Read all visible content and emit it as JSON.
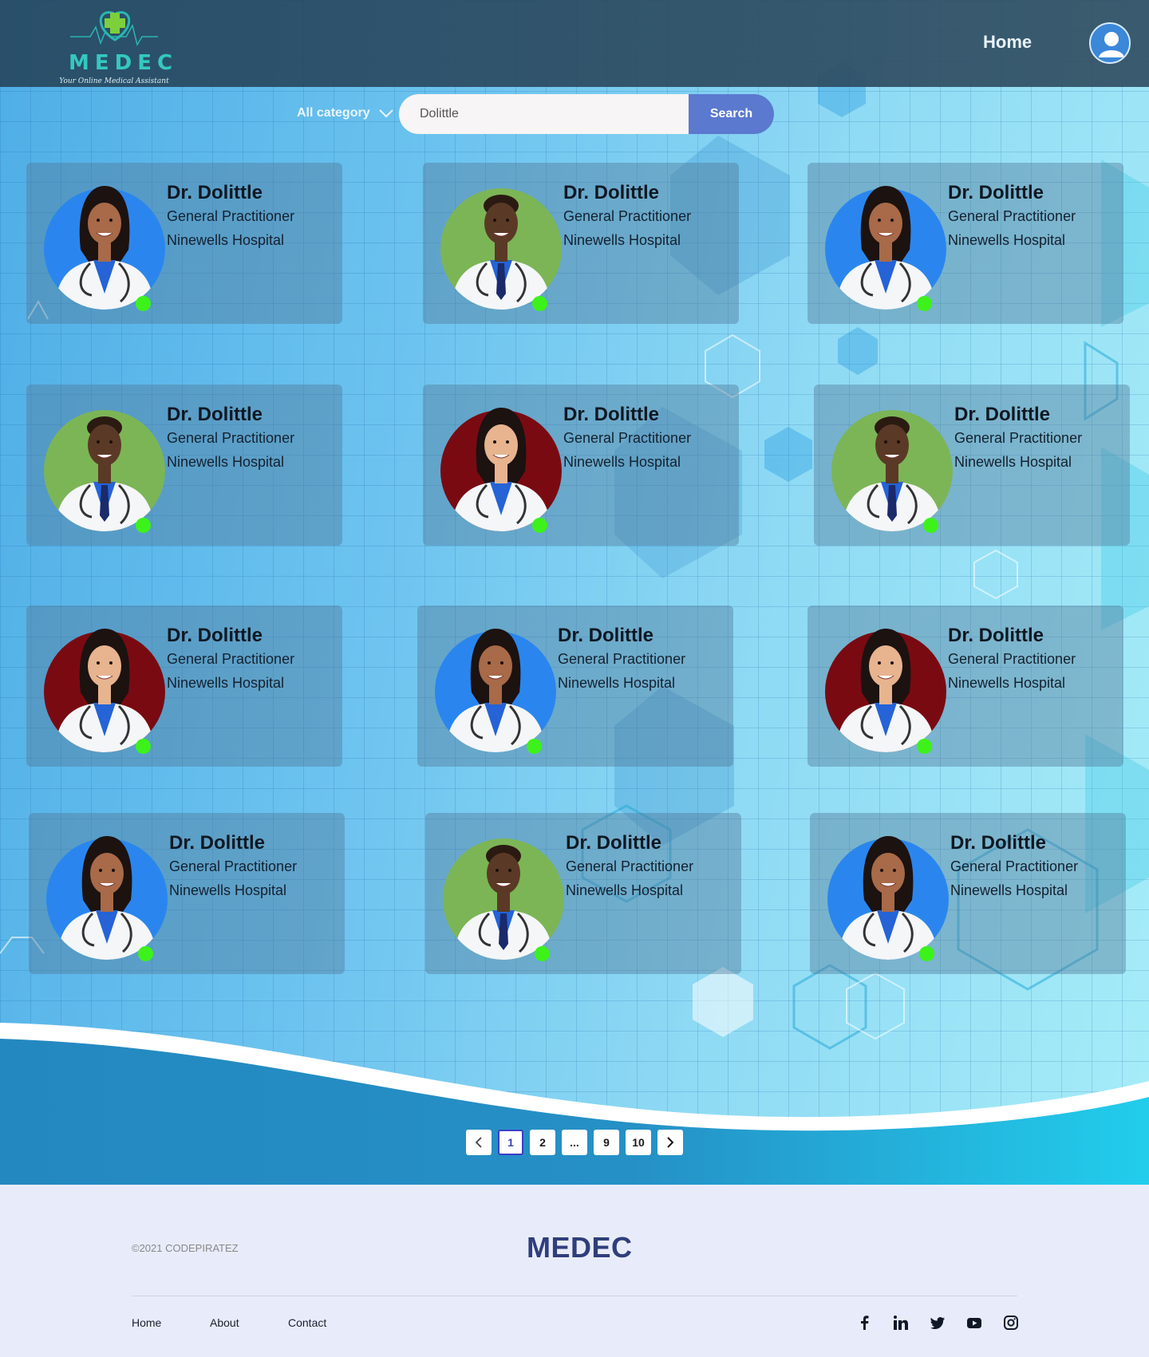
{
  "header": {
    "logo_text": "MEDEC",
    "logo_tagline": "Your Online Medical Assistant",
    "nav_home": "Home",
    "avatar_icon": "user-icon"
  },
  "search": {
    "category_label": "All category",
    "category_icon": "chevron-down-icon",
    "value": "Dolittle",
    "button_label": "Search"
  },
  "doctors": [
    {
      "name": "Dr. Dolittle",
      "specialty": "General Practitioner",
      "hospital": "Ninewells Hospital",
      "portrait": "female-doctor",
      "bg": "#2a86ee",
      "online": true
    },
    {
      "name": "Dr. Dolittle",
      "specialty": "General Practitioner",
      "hospital": "Ninewells Hospital",
      "portrait": "male-doctor",
      "bg": "#7cb556",
      "online": true
    },
    {
      "name": "Dr. Dolittle",
      "specialty": "General Practitioner",
      "hospital": "Ninewells Hospital",
      "portrait": "female-doctor",
      "bg": "#2a86ee",
      "online": true
    },
    {
      "name": "Dr. Dolittle",
      "specialty": "General Practitioner",
      "hospital": "Ninewells Hospital",
      "portrait": "male-doctor",
      "bg": "#7cb556",
      "online": true
    },
    {
      "name": "Dr. Dolittle",
      "specialty": "General Practitioner",
      "hospital": "Ninewells Hospital",
      "portrait": "female-doctor-2",
      "bg": "#7a0a12",
      "online": true
    },
    {
      "name": "Dr. Dolittle",
      "specialty": "General Practitioner",
      "hospital": "Ninewells Hospital",
      "portrait": "male-doctor",
      "bg": "#7cb556",
      "online": true
    },
    {
      "name": "Dr. Dolittle",
      "specialty": "General Practitioner",
      "hospital": "Ninewells Hospital",
      "portrait": "female-doctor-2",
      "bg": "#7a0a12",
      "online": true
    },
    {
      "name": "Dr. Dolittle",
      "specialty": "General Practitioner",
      "hospital": "Ninewells Hospital",
      "portrait": "female-doctor",
      "bg": "#2a86ee",
      "online": true
    },
    {
      "name": "Dr. Dolittle",
      "specialty": "General Practitioner",
      "hospital": "Ninewells Hospital",
      "portrait": "female-doctor-2",
      "bg": "#7a0a12",
      "online": true
    },
    {
      "name": "Dr. Dolittle",
      "specialty": "General Practitioner",
      "hospital": "Ninewells Hospital",
      "portrait": "female-doctor",
      "bg": "#2a86ee",
      "online": true
    },
    {
      "name": "Dr. Dolittle",
      "specialty": "General Practitioner",
      "hospital": "Ninewells Hospital",
      "portrait": "male-doctor",
      "bg": "#7cb556",
      "online": true
    },
    {
      "name": "Dr. Dolittle",
      "specialty": "General Practitioner",
      "hospital": "Ninewells Hospital",
      "portrait": "female-doctor",
      "bg": "#2a86ee",
      "online": true
    }
  ],
  "pagination": {
    "prev_icon": "chevron-left-icon",
    "next_icon": "chevron-right-icon",
    "pages": [
      "1",
      "2",
      "...",
      "9",
      "10"
    ],
    "current": "1"
  },
  "footer": {
    "copyright": "©2021 CODEPIRATEZ",
    "brand": "MEDEC",
    "links": [
      "Home",
      "About",
      "Contact"
    ],
    "social_icons": [
      "facebook-icon",
      "linkedin-icon",
      "twitter-icon",
      "youtube-icon",
      "instagram-icon"
    ]
  },
  "colors": {
    "accent": "#5b79cf",
    "online": "#3cf21a",
    "brand_dark": "#2f3e7c",
    "logo_teal": "#34c8c0"
  }
}
